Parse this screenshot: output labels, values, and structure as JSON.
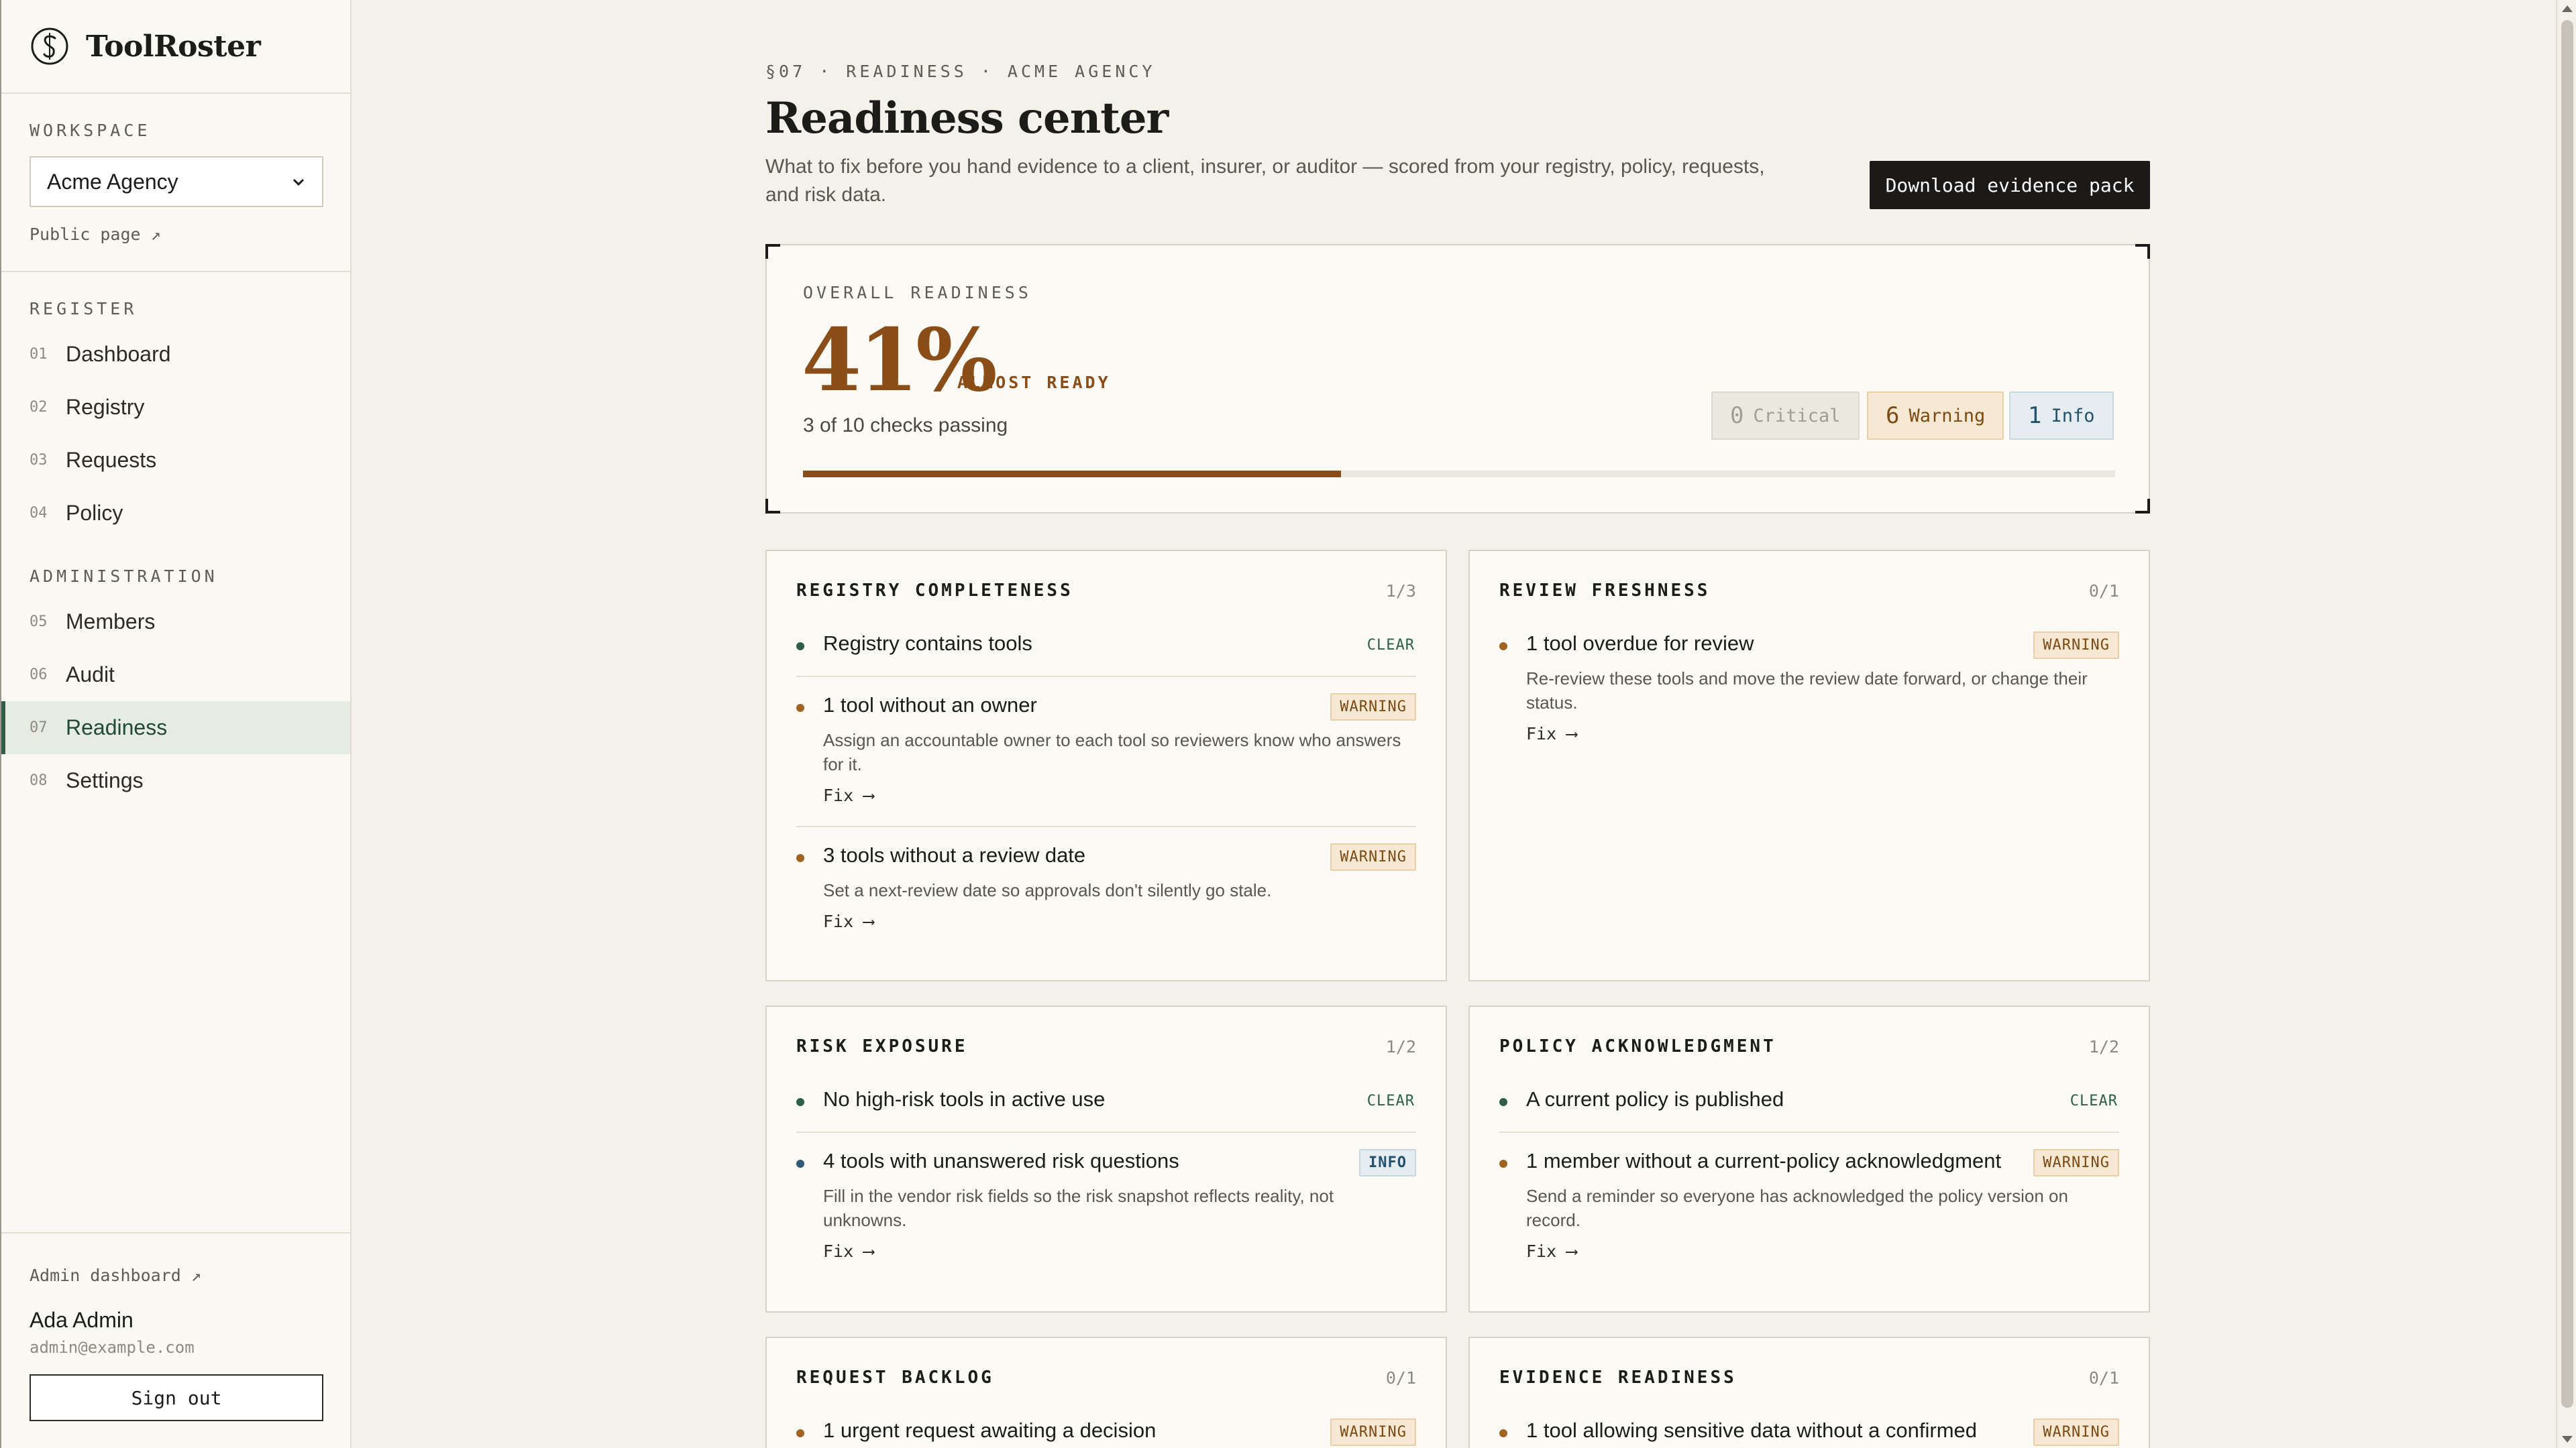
{
  "brand": {
    "name": "ToolRoster"
  },
  "sidebar": {
    "workspace_label": "WORKSPACE",
    "workspace_value": "Acme Agency",
    "public_page": "Public page ↗",
    "register_label": "REGISTER",
    "register_items": [
      {
        "num": "01",
        "label": "Dashboard"
      },
      {
        "num": "02",
        "label": "Registry"
      },
      {
        "num": "03",
        "label": "Requests"
      },
      {
        "num": "04",
        "label": "Policy"
      }
    ],
    "admin_label": "ADMINISTRATION",
    "admin_items": [
      {
        "num": "05",
        "label": "Members"
      },
      {
        "num": "06",
        "label": "Audit"
      },
      {
        "num": "07",
        "label": "Readiness"
      },
      {
        "num": "08",
        "label": "Settings"
      }
    ],
    "admin_dashboard": "Admin dashboard ↗",
    "user_name": "Ada Admin",
    "user_email": "admin@example.com",
    "sign_out": "Sign out"
  },
  "header": {
    "eyebrow": "§07 · READINESS · ACME AGENCY",
    "title": "Readiness center",
    "subtitle": "What to fix before you hand evidence to a client, insurer, or auditor — scored from your registry, policy, requests, and risk data.",
    "download_label": "Download evidence pack"
  },
  "overall": {
    "label": "OVERALL READINESS",
    "score": "41%",
    "status": "ALMOST READY",
    "checks_text": "3 of 10 checks passing",
    "progress_percent": 41,
    "critical_count": "0",
    "critical_label": "Critical",
    "warning_count": "6",
    "warning_label": "Warning",
    "info_count": "1",
    "info_label": "Info"
  },
  "cards": {
    "registry": {
      "title": "REGISTRY COMPLETENESS",
      "count": "1/3",
      "c1_title": "Registry contains tools",
      "c1_badge": "CLEAR",
      "c2_title": "1 tool without an owner",
      "c2_badge": "WARNING",
      "c2_desc": "Assign an accountable owner to each tool so reviewers know who answers for it.",
      "c3_title": "3 tools without a review date",
      "c3_badge": "WARNING",
      "c3_desc": "Set a next-review date so approvals don't silently go stale."
    },
    "review": {
      "title": "REVIEW FRESHNESS",
      "count": "0/1",
      "c1_title": "1 tool overdue for review",
      "c1_badge": "WARNING",
      "c1_desc": "Re-review these tools and move the review date forward, or change their status."
    },
    "risk": {
      "title": "RISK EXPOSURE",
      "count": "1/2",
      "c1_title": "No high-risk tools in active use",
      "c1_badge": "CLEAR",
      "c2_title": "4 tools with unanswered risk questions",
      "c2_badge": "INFO",
      "c2_desc": "Fill in the vendor risk fields so the risk snapshot reflects reality, not unknowns."
    },
    "policy": {
      "title": "POLICY ACKNOWLEDGMENT",
      "count": "1/2",
      "c1_title": "A current policy is published",
      "c1_badge": "CLEAR",
      "c2_title": "1 member without a current-policy acknowledgment",
      "c2_badge": "WARNING",
      "c2_desc": "Send a reminder so everyone has acknowledged the policy version on record."
    },
    "requests": {
      "title": "REQUEST BACKLOG",
      "count": "0/1",
      "c1_title": "1 urgent request awaiting a decision",
      "c1_badge": "WARNING"
    },
    "evidence": {
      "title": "EVIDENCE READINESS",
      "count": "0/1",
      "c1_title": "1 tool allowing sensitive data without a confirmed",
      "c1_badge": "WARNING"
    },
    "fix_label": "Fix ⟶"
  },
  "colors": {
    "accent": "#8a4d17",
    "clear": "#2f5d45",
    "info": "#24516e",
    "background": "#f3f1ea"
  }
}
